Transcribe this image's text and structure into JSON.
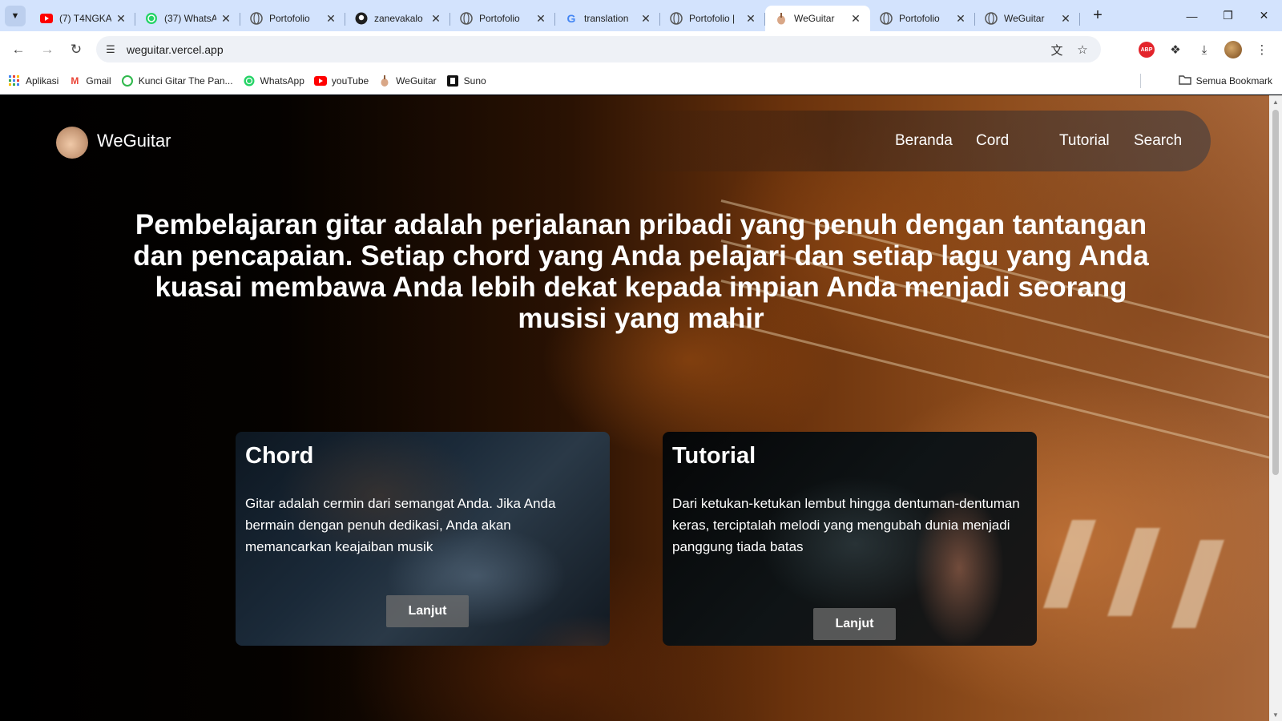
{
  "browser": {
    "tabs": [
      {
        "title": "(7) T4NGKA",
        "icon": "youtube-icon",
        "active": false
      },
      {
        "title": "(37) WhatsA",
        "icon": "whatsapp-icon",
        "active": false
      },
      {
        "title": "Portofolio",
        "icon": "globe-icon",
        "active": false
      },
      {
        "title": "zanevakalo",
        "icon": "github-icon",
        "active": false
      },
      {
        "title": "Portofolio",
        "icon": "globe-icon",
        "active": false
      },
      {
        "title": "translation",
        "icon": "google-icon",
        "active": false
      },
      {
        "title": "Portofolio |",
        "icon": "globe-icon",
        "active": false
      },
      {
        "title": "WeGuitar",
        "icon": "weguitar-icon",
        "active": true
      },
      {
        "title": "Portofolio",
        "icon": "globe-icon",
        "active": false
      },
      {
        "title": "WeGuitar",
        "icon": "globe-icon",
        "active": false
      }
    ],
    "url": "weguitar.vercel.app",
    "bookmarks": [
      {
        "label": "Aplikasi",
        "icon": "apps-grid-icon"
      },
      {
        "label": "Gmail",
        "icon": "gmail-icon"
      },
      {
        "label": "Kunci Gitar The Pan...",
        "icon": "chord-site-icon"
      },
      {
        "label": "WhatsApp",
        "icon": "whatsapp-icon"
      },
      {
        "label": "youTube",
        "icon": "youtube-icon"
      },
      {
        "label": "WeGuitar",
        "icon": "weguitar-icon"
      },
      {
        "label": "Suno",
        "icon": "suno-icon"
      }
    ],
    "all_bookmarks": "Semua Bookmark"
  },
  "site": {
    "name": "WeGuitar",
    "nav": [
      "Beranda",
      "Cord",
      "Tutorial",
      "Search"
    ],
    "hero": "Pembelajaran gitar adalah perjalanan pribadi yang penuh dengan tantangan dan pencapaian. Setiap chord yang Anda pelajari dan setiap lagu yang Anda kuasai membawa Anda lebih dekat kepada impian Anda menjadi seorang musisi yang mahir",
    "cards": [
      {
        "title": "Chord",
        "text": "Gitar adalah cermin dari semangat Anda. Jika Anda bermain dengan penuh dedikasi, Anda akan memancarkan keajaiban musik",
        "button": "Lanjut"
      },
      {
        "title": "Tutorial",
        "text": "Dari ketukan-ketukan lembut hingga dentuman-dentuman keras, terciptalah melodi yang mengubah dunia menjadi panggung tiada batas",
        "button": "Lanjut"
      }
    ]
  },
  "colors": {
    "tabstrip": "#d3e3fd",
    "page_bg": "#000000",
    "accent_wood": "#a8673a"
  }
}
